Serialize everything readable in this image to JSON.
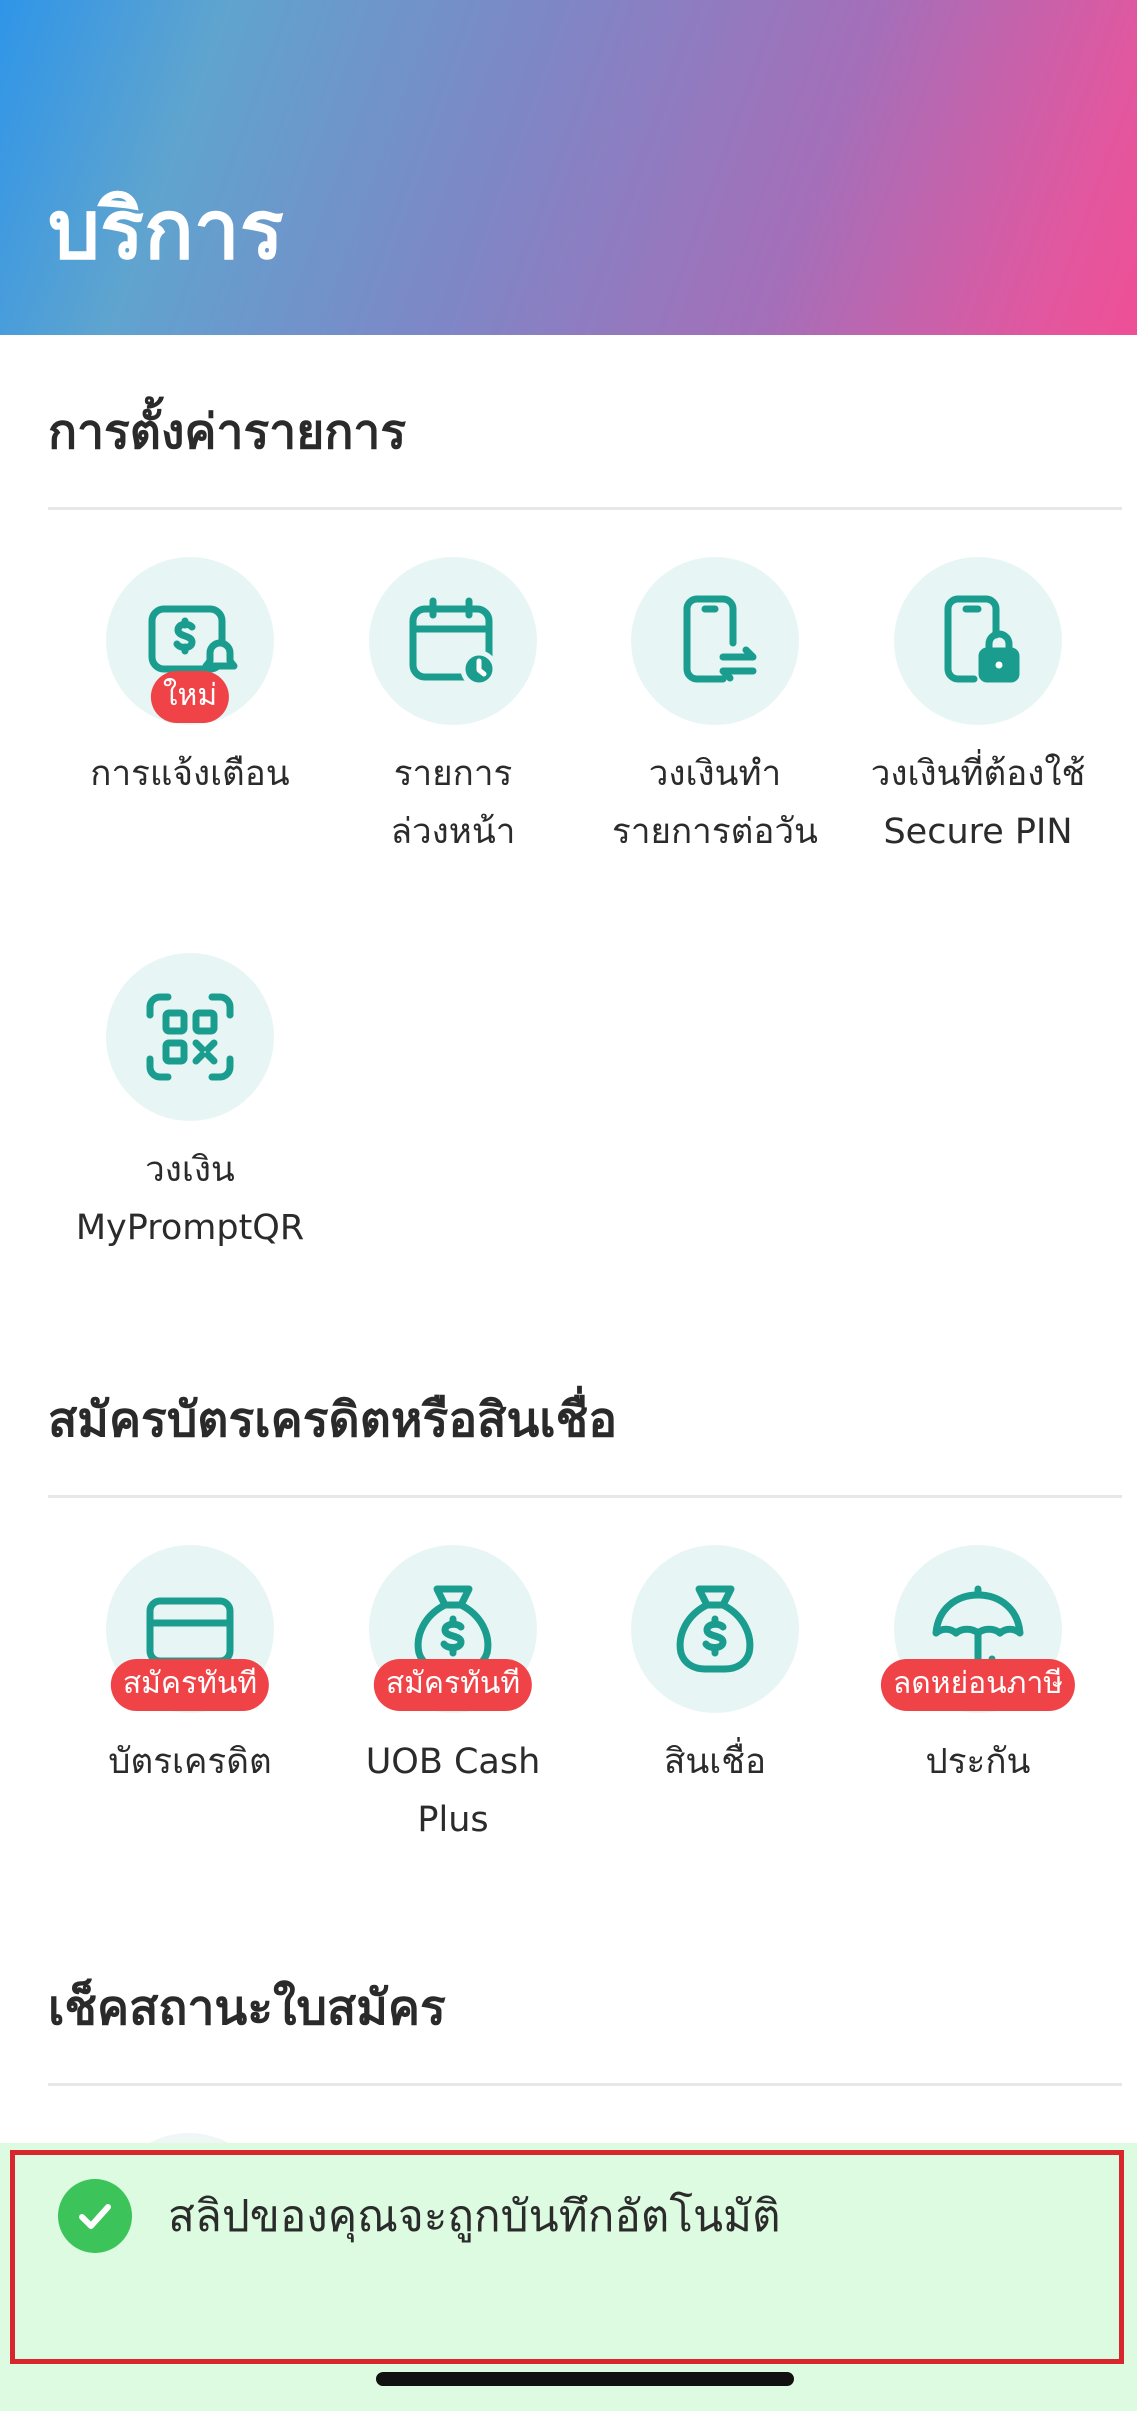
{
  "header": {
    "title": "บริการ"
  },
  "sections": [
    {
      "title": "การตั้งค่ารายการ",
      "tiles": [
        {
          "label": "การแจ้งเตือน",
          "icon": "money-alert-icon",
          "badge": "ใหม่"
        },
        {
          "label": "รายการ\nล่วงหน้า",
          "icon": "calendar-clock-icon"
        },
        {
          "label": "วงเงินทำ\nรายการต่อวัน",
          "icon": "phone-transfer-icon"
        },
        {
          "label": "วงเงินที่ต้องใช้\nSecure PIN",
          "icon": "phone-lock-icon"
        },
        {
          "label": "วงเงิน\nMyPromptQR",
          "icon": "qr-scan-icon"
        }
      ]
    },
    {
      "title": "สมัครบัตรเครดิตหรือสินเชื่อ",
      "tiles": [
        {
          "label": "บัตรเครดิต",
          "icon": "credit-card-icon",
          "badge": "สมัครทันที"
        },
        {
          "label": "UOB Cash\nPlus",
          "icon": "money-bag-icon",
          "badge": "สมัครทันที"
        },
        {
          "label": "สินเชื่อ",
          "icon": "money-bag-icon"
        },
        {
          "label": "ประกัน",
          "icon": "umbrella-icon",
          "badge": "ลดหย่อนภาษี"
        }
      ]
    },
    {
      "title": "เช็คสถานะใบสมัคร"
    }
  ],
  "toast": {
    "message": "สลิปของคุณจะถูกบันทึกอัตโนมัติ",
    "icon": "check-circle-icon"
  },
  "colors": {
    "accent": "#1a9d8f",
    "badge": "#f04347",
    "toast_bg": "#dcfbe0",
    "success": "#3cc35a"
  }
}
